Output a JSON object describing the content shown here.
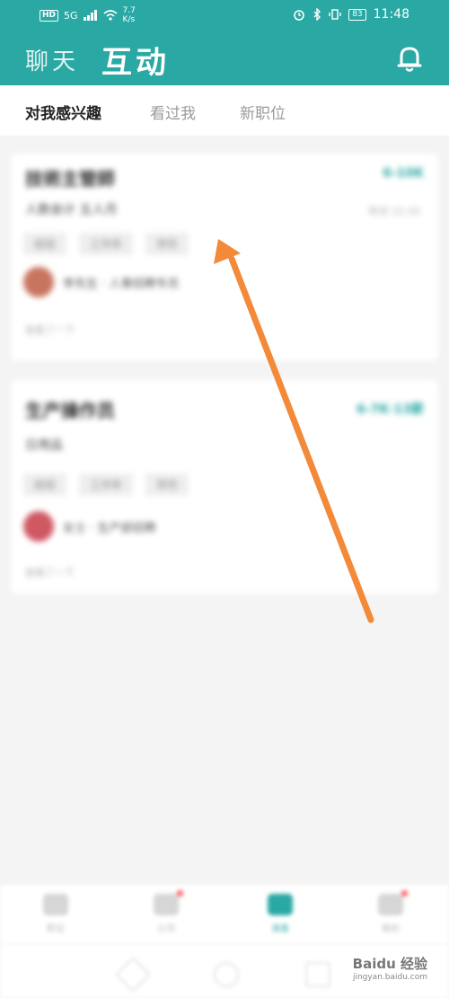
{
  "status_bar": {
    "hd": "HD",
    "network": "5G",
    "speed_value": "7.7",
    "speed_unit": "K/s",
    "battery": "83",
    "time": "11:48"
  },
  "header": {
    "tab_chat": "聊天",
    "tab_interact": "互动",
    "bell_icon": "bell-icon"
  },
  "sub_tabs": [
    {
      "label": "对我感兴趣",
      "active": true
    },
    {
      "label": "看过我",
      "active": false
    },
    {
      "label": "新职位",
      "active": false
    }
  ],
  "cards": [
    {
      "title": "技術主管師",
      "salary": "6-10K",
      "meta": "人数会计  五人月",
      "time": "昨天 11:33",
      "tags": [
        "经验",
        "工作年",
        "学历"
      ],
      "recruiter": "李先生 · 人事招聘专员",
      "footer": "查看了一下",
      "avatar_color": "#c8755f"
    },
    {
      "title": "生产操作员",
      "salary": "6-7K·13薪",
      "meta": "日用品",
      "time": "",
      "tags": [
        "经验",
        "工作年",
        "学历"
      ],
      "recruiter": "女士 · 生产部招聘",
      "footer": "查看了一下",
      "avatar_color": "#cf5863"
    }
  ],
  "bottom_nav": [
    {
      "label": "职位",
      "active": false,
      "badge": false
    },
    {
      "label": "公司",
      "active": false,
      "badge": true
    },
    {
      "label": "消息",
      "active": true,
      "badge": false
    },
    {
      "label": "我的",
      "active": false,
      "badge": true
    }
  ],
  "watermark": {
    "brand": "Baidu 经验",
    "url": "jingyan.baidu.com"
  },
  "colors": {
    "accent": "#2aa8a4",
    "annotation_arrow": "#f28a3a"
  }
}
